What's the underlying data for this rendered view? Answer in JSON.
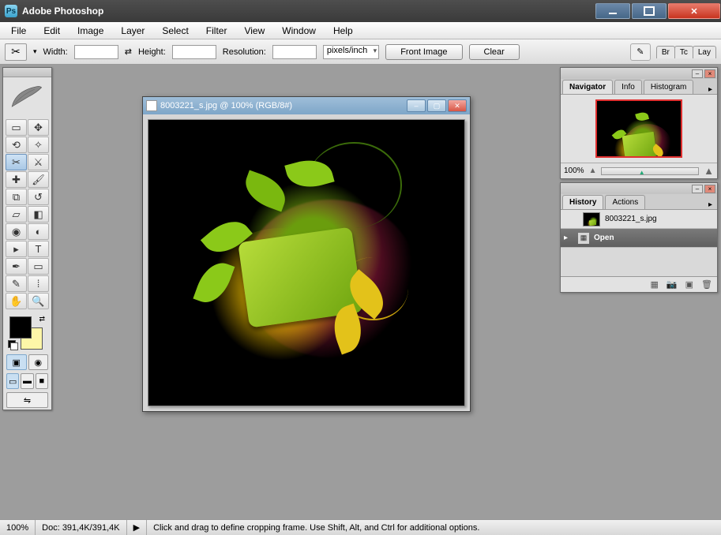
{
  "app": {
    "title": "Adobe Photoshop"
  },
  "menu": [
    "File",
    "Edit",
    "Image",
    "Layer",
    "Select",
    "Filter",
    "View",
    "Window",
    "Help"
  ],
  "options": {
    "width_label": "Width:",
    "width_value": "",
    "height_label": "Height:",
    "height_value": "",
    "resolution_label": "Resolution:",
    "resolution_value": "",
    "resolution_unit": "pixels/inch",
    "front_image_btn": "Front Image",
    "clear_btn": "Clear",
    "wells_tabs": [
      "Br",
      "Tc",
      "Lay"
    ]
  },
  "document": {
    "title": "8003221_s.jpg @ 100% (RGB/8#)"
  },
  "navigator": {
    "tabs": [
      "Navigator",
      "Info",
      "Histogram"
    ],
    "active_tab": 0,
    "zoom": "100%"
  },
  "history": {
    "tabs": [
      "History",
      "Actions"
    ],
    "active_tab": 0,
    "source_name": "8003221_s.jpg",
    "states": [
      {
        "label": "Open",
        "selected": true
      }
    ]
  },
  "status": {
    "zoom": "100%",
    "doc_size": "Doc: 391,4K/391,4K",
    "hint": "Click and drag to define cropping frame. Use Shift, Alt, and Ctrl for additional options."
  },
  "colors": {
    "foreground": "#000000",
    "background": "#fdf6a8"
  },
  "tools": [
    "marquee",
    "move",
    "lasso",
    "magic-wand",
    "crop",
    "slice",
    "healing",
    "brush",
    "clone",
    "history-brush",
    "eraser",
    "gradient",
    "blur",
    "dodge",
    "path-select",
    "type",
    "pen",
    "shape",
    "notes",
    "eyedropper",
    "hand",
    "zoom"
  ],
  "active_tool": "crop"
}
